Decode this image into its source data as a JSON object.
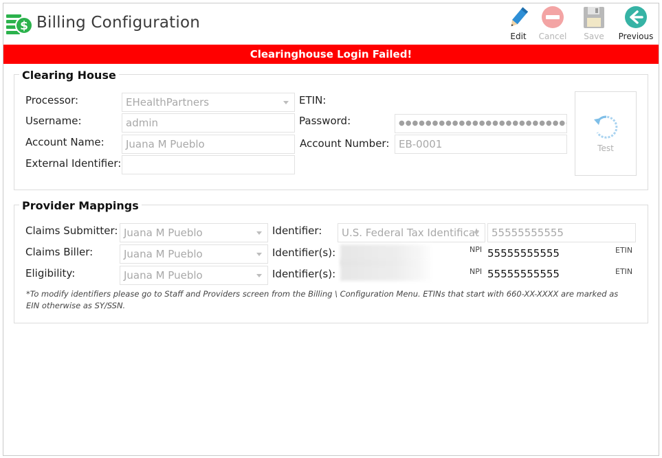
{
  "header": {
    "title": "Billing Configuration",
    "logo_icon": "money-stack-icon",
    "toolbar": {
      "edit_label": "Edit",
      "cancel_label": "Cancel",
      "save_label": "Save",
      "previous_label": "Previous"
    }
  },
  "banner": {
    "message": "Clearinghouse Login Failed!",
    "color": "#ff0000"
  },
  "clearing_house": {
    "title": "Clearing House",
    "processor_label": "Processor:",
    "processor_value": "EHealthPartners",
    "etin_label": "ETIN:",
    "username_label": "Username:",
    "username_value": "admin",
    "password_label": "Password:",
    "password_value": "●●●●●●●●●●●●●●●●●●●●●●●●●●●",
    "account_name_label": "Account Name:",
    "account_name_value": "Juana M Pueblo",
    "account_number_label": "Account Number:",
    "account_number_value": "EB-0001",
    "external_identifier_label": "External Identifier:",
    "external_identifier_value": "",
    "test_label": "Test"
  },
  "provider_mappings": {
    "title": "Provider Mappings",
    "claims_submitter_label": "Claims Submitter:",
    "claims_submitter_value": "Juana M Pueblo",
    "identifier_label": "Identifier:",
    "identifier_type_value": "U.S. Federal Tax Identificat",
    "identifier_value": "55555555555",
    "claims_biller_label": "Claims Biller:",
    "claims_biller_value": "Juana M Pueblo",
    "identifiers_label": "Identifier(s):",
    "npi_label": "NPI",
    "etin_label": "ETIN",
    "biller_npi_value": "55555555555",
    "eligibility_label": "Eligibility:",
    "eligibility_value": "Juana M Pueblo",
    "eligibility_npi_value": "55555555555",
    "note": "*To modify identifiers please go to Staff and Providers screen from the Billing \\ Configuration Menu. ETINs that start with 660-XX-XXXX are marked as EIN otherwise as SY/SSN."
  }
}
